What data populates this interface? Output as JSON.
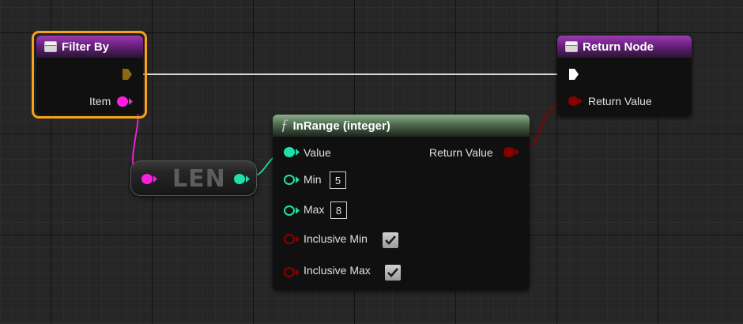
{
  "filter_node": {
    "title": "Filter By",
    "title_icon": "event-icon",
    "pin_item_label": "Item",
    "header_color": "#6b2080",
    "selection_color": "#f7a21b"
  },
  "return_node": {
    "title": "Return Node",
    "title_icon": "event-icon",
    "pin_return_value_label": "Return Value",
    "header_color": "#6b2080"
  },
  "len_node": {
    "label": "LEN"
  },
  "inrange_node": {
    "title": "InRange (integer)",
    "title_icon": "function-icon",
    "header_color": "#4e6a4e",
    "pins": {
      "value_label": "Value",
      "min_label": "Min",
      "min_value": "5",
      "max_label": "Max",
      "max_value": "8",
      "inclusive_min_label": "Inclusive Min",
      "inclusive_min_checked": true,
      "inclusive_max_label": "Inclusive Max",
      "inclusive_max_checked": true,
      "return_value_label": "Return Value"
    }
  },
  "pin_colors": {
    "exec_filter": "#8a6a10",
    "exec_return": "#ffffff",
    "string": "#ff1ee0",
    "integer": "#1fe0a8",
    "boolean": "#8a0000"
  }
}
